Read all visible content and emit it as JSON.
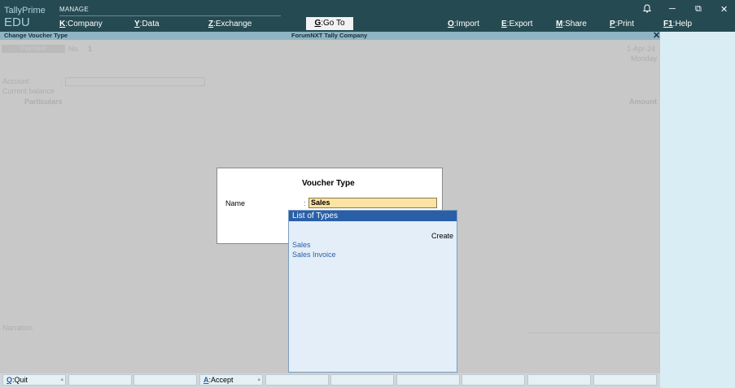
{
  "app": {
    "brand_line1": "TallyPrime",
    "brand_line2": "EDU",
    "manage_label": "MANAGE"
  },
  "top_menu": {
    "company": {
      "key": "K",
      "label": ":Company"
    },
    "data": {
      "key": "Y",
      "label": ":Data"
    },
    "exchange": {
      "key": "Z",
      "label": ":Exchange"
    },
    "goto": {
      "key": "G",
      "label": ":Go To"
    },
    "import": {
      "key": "O",
      "label": ":Import"
    },
    "export": {
      "key": "E",
      "label": ":Export"
    },
    "share": {
      "key": "M",
      "label": ":Share"
    },
    "print": {
      "key": "P",
      "label": ":Print"
    },
    "help": {
      "key": "F1",
      "label": ":Help"
    }
  },
  "window_icons": {
    "bell": "🔔",
    "minimize": "─",
    "restore": "⧉",
    "close": "✕"
  },
  "title_bar": {
    "left": "Change Voucher Type",
    "center": "ForumNXT Tally Company",
    "close": "✕"
  },
  "background_voucher": {
    "type_badge": "Payment",
    "no_label": "No.",
    "no_value": "1",
    "date": "1-Apr-24",
    "day": "Monday",
    "account_label": "Account",
    "account_colon": ":",
    "current_balance_label": "Current balance",
    "particulars_label": "Particulars",
    "amount_label": "Amount",
    "narration_label": "Narration"
  },
  "voucher_type_dialog": {
    "title": "Voucher Type",
    "name_label": "Name",
    "colon": ":",
    "name_value": "Sales"
  },
  "list_of_types": {
    "header": "List of Types",
    "create_label": "Create",
    "items": [
      "Sales",
      "Sales Invoice"
    ]
  },
  "bottom_bar": {
    "quit": {
      "key": "Q",
      "label": ":Quit"
    },
    "accept": {
      "key": "A",
      "label": ":Accept"
    }
  },
  "colors": {
    "top_bar": "#264a52",
    "title_bar": "#8fb5c4",
    "list_header": "#2a5fa8",
    "input_highlight": "#fbe3a3"
  }
}
